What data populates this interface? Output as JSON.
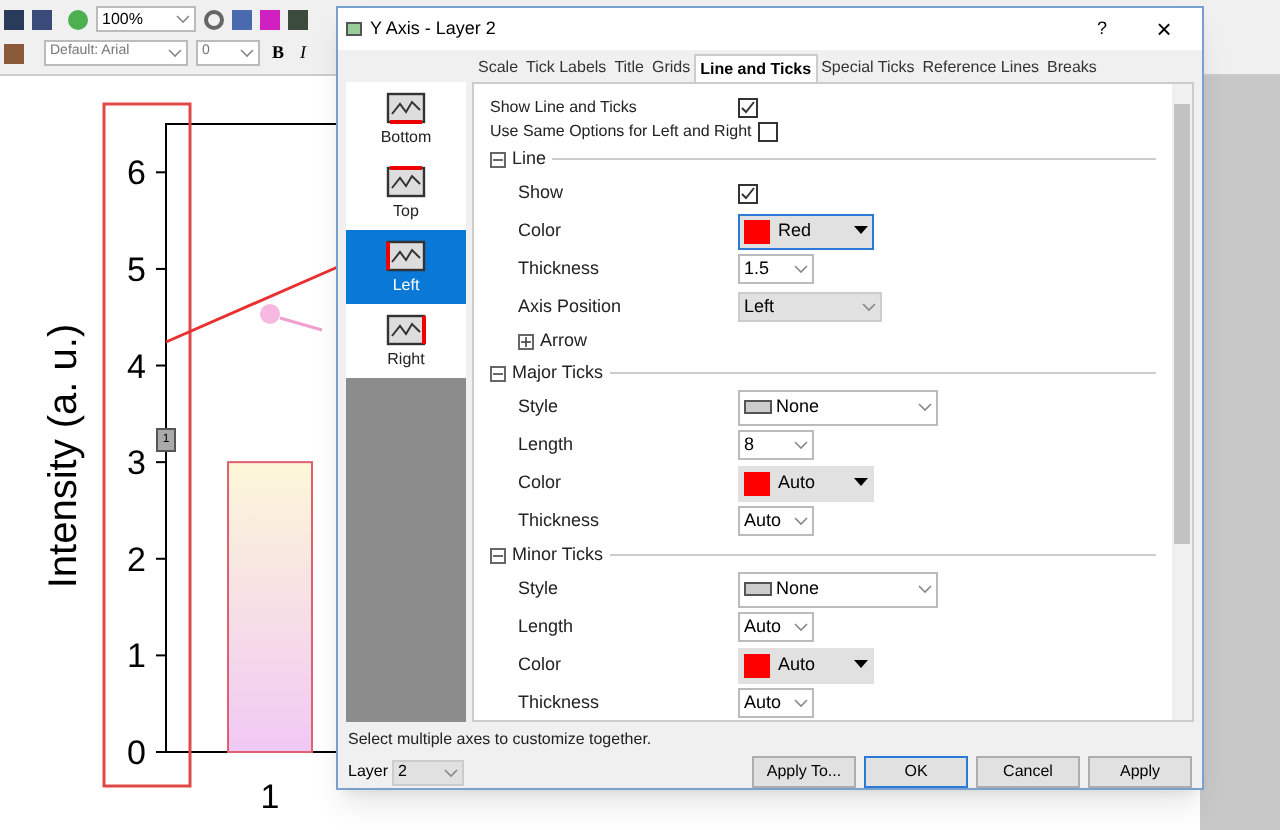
{
  "toolbar": {
    "zoom": "100%",
    "font": "Default: Arial",
    "font_size": "0",
    "bold": "B",
    "italic": "I"
  },
  "chart": {
    "layer_marker": "1",
    "chart_data": {
      "type": "bar",
      "ylabel": "Intensity (a. u.)",
      "categories": [
        "1"
      ],
      "values": [
        3
      ],
      "ylim": [
        0,
        6.5
      ],
      "yticks": [
        0,
        1,
        2,
        3,
        4,
        5,
        6
      ]
    }
  },
  "dialog": {
    "title": "Y Axis - Layer 2",
    "help": "?",
    "close": "×",
    "tabs": [
      {
        "label": "Scale",
        "selected": false
      },
      {
        "label": "Tick Labels",
        "selected": false
      },
      {
        "label": "Title",
        "selected": false
      },
      {
        "label": "Grids",
        "selected": false
      },
      {
        "label": "Line and Ticks",
        "selected": true
      },
      {
        "label": "Special Ticks",
        "selected": false
      },
      {
        "label": "Reference Lines",
        "selected": false
      },
      {
        "label": "Breaks",
        "selected": false
      }
    ],
    "axes": [
      {
        "label": "Bottom",
        "selected": false
      },
      {
        "label": "Top",
        "selected": false
      },
      {
        "label": "Left",
        "selected": true
      },
      {
        "label": "Right",
        "selected": false
      }
    ],
    "options": [
      {
        "label": "Show Line and Ticks",
        "checked": true
      },
      {
        "label": "Use Same Options for Left and Right",
        "checked": false
      }
    ],
    "groups": [
      {
        "title": "Line",
        "expanded": true,
        "rows": [
          {
            "kind": "checkbox",
            "label": "Show",
            "checked": true
          },
          {
            "kind": "color",
            "label": "Color",
            "value": "Red",
            "color": "#ff0000",
            "focused": true
          },
          {
            "kind": "combo",
            "label": "Thickness",
            "value": "1.5"
          },
          {
            "kind": "list",
            "label": "Axis Position",
            "value": "Left"
          },
          {
            "kind": "expander",
            "label": "Arrow",
            "expanded": false
          }
        ]
      },
      {
        "title": "Major Ticks",
        "expanded": true,
        "rows": [
          {
            "kind": "style",
            "label": "Style",
            "value": "None"
          },
          {
            "kind": "combo",
            "label": "Length",
            "value": "8"
          },
          {
            "kind": "color",
            "label": "Color",
            "value": "Auto",
            "color": "#ff0000",
            "focused": false
          },
          {
            "kind": "combo",
            "label": "Thickness",
            "value": "Auto"
          }
        ]
      },
      {
        "title": "Minor Ticks",
        "expanded": true,
        "rows": [
          {
            "kind": "style",
            "label": "Style",
            "value": "None"
          },
          {
            "kind": "combo",
            "label": "Length",
            "value": "Auto"
          },
          {
            "kind": "color",
            "label": "Color",
            "value": "Auto",
            "color": "#ff0000",
            "focused": false
          },
          {
            "kind": "combo",
            "label": "Thickness",
            "value": "Auto"
          }
        ]
      }
    ],
    "hint": "Select multiple axes to customize together.",
    "layer": {
      "label": "Layer",
      "value": "2"
    },
    "buttons": [
      {
        "label": "Apply To...",
        "default": false
      },
      {
        "label": "OK",
        "default": true
      },
      {
        "label": "Cancel",
        "default": false
      },
      {
        "label": "Apply",
        "default": false
      }
    ]
  }
}
